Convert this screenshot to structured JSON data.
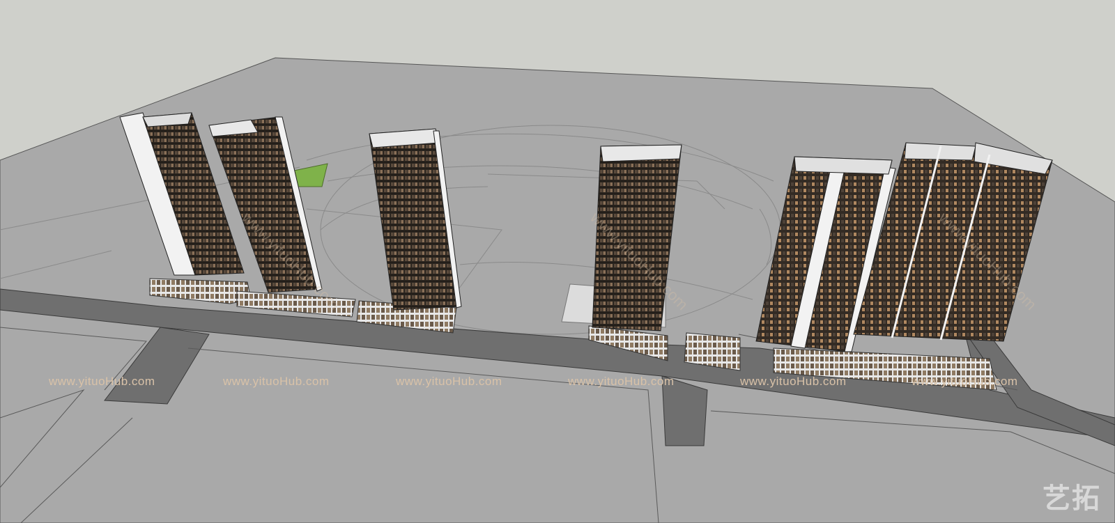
{
  "watermark": {
    "text": "www.yituoHub.com",
    "logo_text": "艺拓",
    "color": "#d9c2a8",
    "logo_color": "#ffffff"
  },
  "colors": {
    "sky": "#cfd0cb",
    "ground": "#a9a9a9",
    "road": "#6f6f6f",
    "facade_dark": "#2c2620",
    "facade_accent": "#b08860",
    "frame": "#f2f2f2",
    "lawn": "#7fb24a"
  },
  "scene": {
    "towers": [
      {
        "name": "tower-1"
      },
      {
        "name": "tower-2"
      },
      {
        "name": "tower-3"
      },
      {
        "name": "tower-4"
      },
      {
        "name": "tower-5"
      },
      {
        "name": "tower-6"
      }
    ]
  }
}
